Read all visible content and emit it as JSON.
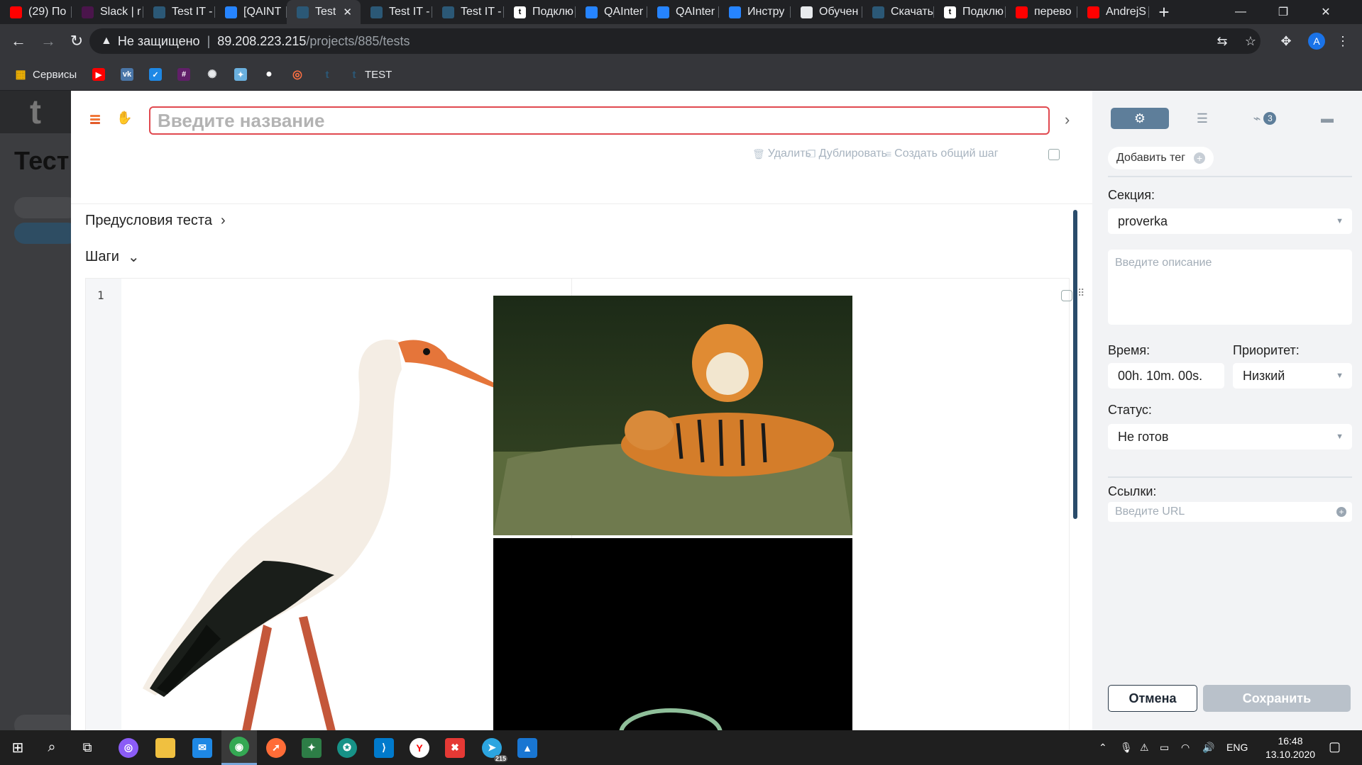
{
  "browser": {
    "tabs": [
      {
        "label": "(29) По",
        "icon": "youtube-icon",
        "color": "#ff0000"
      },
      {
        "label": "Slack | r",
        "icon": "slack-icon",
        "color": "#4a154b"
      },
      {
        "label": "Test IT -",
        "icon": "testit-icon",
        "color": "#2b5876"
      },
      {
        "label": "[QAINT",
        "icon": "jira-icon",
        "color": "#2684ff"
      },
      {
        "label": "Test",
        "icon": "testit-icon",
        "color": "#2b5876",
        "active": true
      },
      {
        "label": "Test IT -",
        "icon": "testit-icon",
        "color": "#2b5876"
      },
      {
        "label": "Test IT -",
        "icon": "testit-icon",
        "color": "#2b5876"
      },
      {
        "label": "Подклю",
        "icon": "t-icon",
        "color": "#ffffff"
      },
      {
        "label": "QAInter",
        "icon": "jira-icon",
        "color": "#2684ff"
      },
      {
        "label": "QAInter",
        "icon": "jira-icon",
        "color": "#2684ff"
      },
      {
        "label": "Инстру",
        "icon": "confluence-icon",
        "color": "#2684ff"
      },
      {
        "label": "Обучен",
        "icon": "openai-icon",
        "color": "#e8eaed"
      },
      {
        "label": "Скачать",
        "icon": "testit-icon",
        "color": "#2b5876"
      },
      {
        "label": "Подклю",
        "icon": "t-icon",
        "color": "#ffffff"
      },
      {
        "label": "перево",
        "icon": "yandex-icon",
        "color": "#ff0000"
      },
      {
        "label": "AndrejS",
        "icon": "yandex-icon",
        "color": "#ff0000"
      }
    ],
    "address": {
      "security": "Не защищено",
      "host": "89.208.223.215",
      "path": "/projects/885/tests"
    },
    "profile_initial": "A",
    "bookmarks": [
      {
        "label": "Сервисы",
        "icon": "apps-grid-icon"
      },
      {
        "label": "",
        "icon": "youtube-icon"
      },
      {
        "label": "",
        "icon": "vk-icon"
      },
      {
        "label": "",
        "icon": "check-icon"
      },
      {
        "label": "",
        "icon": "slack-icon"
      },
      {
        "label": "",
        "icon": "openai-icon"
      },
      {
        "label": "",
        "icon": "app-icon"
      },
      {
        "label": "",
        "icon": "github-icon"
      },
      {
        "label": "",
        "icon": "target-icon"
      },
      {
        "label": "",
        "icon": "testit-icon"
      },
      {
        "label": "TEST",
        "icon": "testit-icon"
      }
    ]
  },
  "background": {
    "title": "Тест"
  },
  "editor": {
    "title_placeholder": "Введите название",
    "actions": {
      "delete": "Удалить",
      "duplicate": "Дублировать",
      "create_shared_step": "Создать общий шаг"
    },
    "preconditions_label": "Предусловия теста",
    "steps_label": "Шаги",
    "step_number": "1"
  },
  "panel": {
    "add_tag": "Добавить тег",
    "attachments_count": "3",
    "section_label": "Секция:",
    "section_value": "proverka",
    "description_placeholder": "Введите описание",
    "time_label": "Время:",
    "time_value": "00h. 10m. 00s.",
    "priority_label": "Приоритет:",
    "priority_value": "Низкий",
    "status_label": "Статус:",
    "status_value": "Не готов",
    "links_label": "Ссылки:",
    "url_placeholder": "Введите URL",
    "cancel": "Отмена",
    "save": "Сохранить"
  },
  "taskbar": {
    "lang": "ENG",
    "time": "16:48",
    "date": "13.10.2020",
    "telegram_badge": "215"
  }
}
